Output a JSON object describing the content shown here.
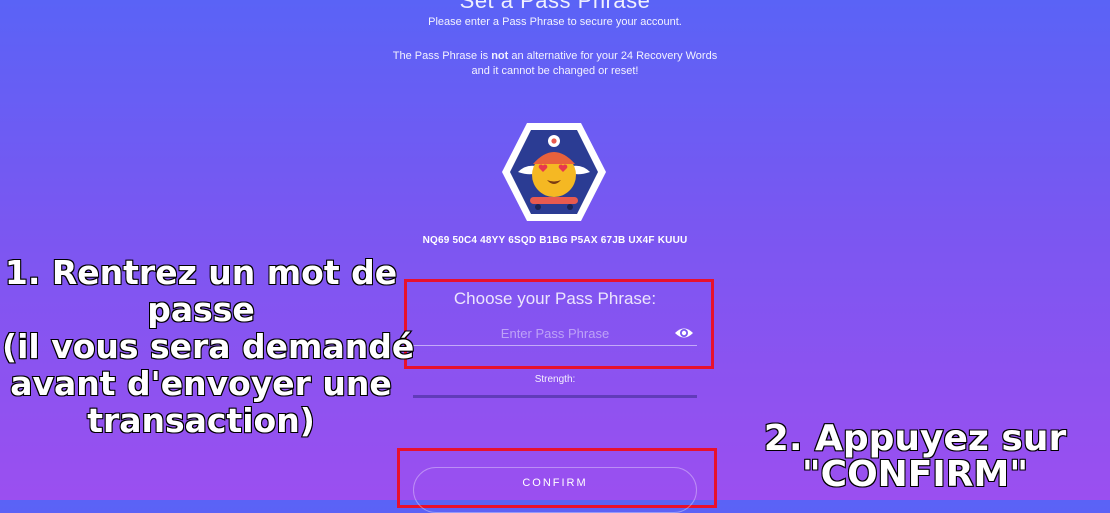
{
  "header": {
    "title": "Set a Pass Phrase",
    "subtitle": "Please enter a Pass Phrase to secure your account."
  },
  "warning": {
    "part1": "The Pass Phrase is ",
    "bold": "not",
    "part2": " an alternative for your 24 Recovery Words and it cannot be changed or reset!"
  },
  "account": {
    "address": "NQ69 50C4 48YY 6SQD B1BG P5AX 67JB UX4F KUUU",
    "avatar_icon": "identicon-avatar-icon"
  },
  "form": {
    "label": "Choose your Pass Phrase:",
    "placeholder": "Enter Pass Phrase",
    "value": "",
    "eye_icon": "eye-icon",
    "strength_label": "Strength:"
  },
  "confirm_button": {
    "label": "CONFIRM"
  },
  "annotations": {
    "step1": [
      "1. Rentrez un mot de",
      "passe",
      "(il vous sera demandé",
      "avant d'envoyer une",
      "transaction)"
    ],
    "step2": [
      "2. Appuyez sur",
      "\"CONFIRM\""
    ],
    "highlight_color": "#e8112d"
  },
  "colors": {
    "gradient_top": "#5a63f6",
    "gradient_bottom": "#9b4ff0",
    "hexagon_border": "#ffffff",
    "hexagon_fill": "#2b3c93"
  }
}
